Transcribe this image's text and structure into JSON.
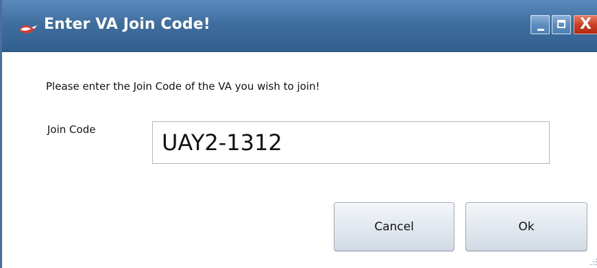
{
  "window": {
    "title": "Enter VA Join Code!",
    "buttons": {
      "minimize_icon": "minimize-icon",
      "maximize_icon": "maximize-icon",
      "close_label": "X"
    }
  },
  "dialog": {
    "prompt": "Please enter the Join Code of the VA you wish to join!",
    "join_code_label": "Join Code",
    "join_code_value": "UAY2-1312",
    "cancel_label": "Cancel",
    "ok_label": "Ok"
  },
  "icons": {
    "app": "app-icon",
    "minimize": "minimize-icon",
    "maximize": "maximize-icon",
    "close": "close-icon",
    "resize": "resize-grip-icon"
  },
  "colors": {
    "titlebar_accent": "#3f6f9f",
    "close_button": "#cc3f24",
    "dialog_background": "#ffffff",
    "button_face": "#e3e9f0"
  }
}
